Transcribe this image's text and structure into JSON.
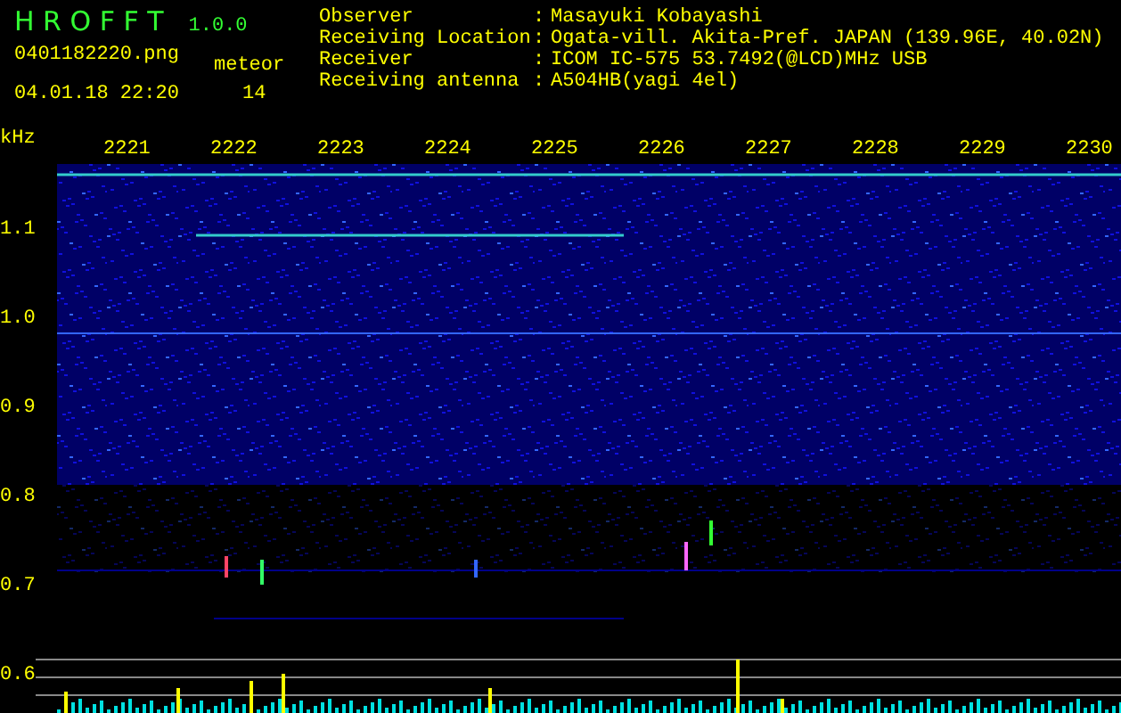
{
  "app": {
    "name": "H R O F F T",
    "version": "1.0.0"
  },
  "file": {
    "filename": "0401182220.png",
    "datetime": "04.01.18 22:20"
  },
  "count": {
    "label": "meteor",
    "value": "14"
  },
  "info": [
    {
      "label": "Observer",
      "sep": ":",
      "value": "Masayuki Kobayashi"
    },
    {
      "label": "Receiving Location",
      "sep": ":",
      "value": "Ogata-vill. Akita-Pref. JAPAN (139.96E, 40.02N)"
    },
    {
      "label": "Receiver",
      "sep": ":",
      "value": "ICOM IC-575 53.7492(@LCD)MHz USB"
    },
    {
      "label": "Receiving antenna",
      "sep": ":",
      "value": "A504HB(yagi 4el)"
    }
  ],
  "axis": {
    "unit": "kHz",
    "time_labels": [
      "2221",
      "2222",
      "2223",
      "2224",
      "2225",
      "2226",
      "2227",
      "2228",
      "2229",
      "2230"
    ],
    "freq_labels": [
      "1.1",
      "1.0",
      "0.9",
      "0.8",
      "0.7",
      "0.6"
    ]
  }
}
